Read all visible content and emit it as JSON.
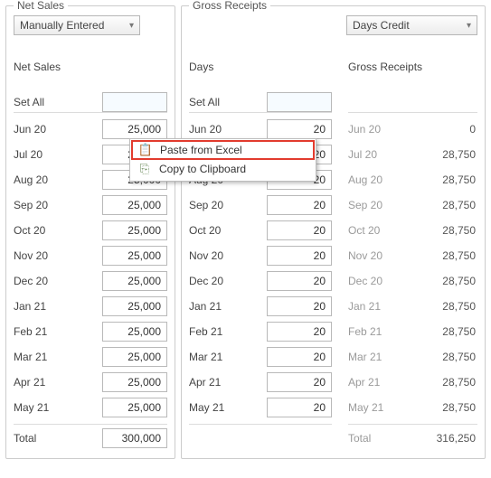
{
  "net_sales": {
    "group_title": "Net Sales",
    "dropdown": "Manually Entered",
    "section_label": "Net Sales",
    "set_all_label": "Set All",
    "set_all_value": "",
    "rows": [
      {
        "label": "Jun 20",
        "value": "25,000"
      },
      {
        "label": "Jul 20",
        "value": "25,000"
      },
      {
        "label": "Aug 20",
        "value": "25,000"
      },
      {
        "label": "Sep 20",
        "value": "25,000"
      },
      {
        "label": "Oct 20",
        "value": "25,000"
      },
      {
        "label": "Nov 20",
        "value": "25,000"
      },
      {
        "label": "Dec 20",
        "value": "25,000"
      },
      {
        "label": "Jan 21",
        "value": "25,000"
      },
      {
        "label": "Feb 21",
        "value": "25,000"
      },
      {
        "label": "Mar 21",
        "value": "25,000"
      },
      {
        "label": "Apr 21",
        "value": "25,000"
      },
      {
        "label": "May 21",
        "value": "25,000"
      }
    ],
    "total_label": "Total",
    "total_value": "300,000"
  },
  "gross": {
    "group_title": "Gross Receipts",
    "dropdown": "Days Credit",
    "days": {
      "section_label": "Days",
      "set_all_label": "Set All",
      "set_all_value": "",
      "rows": [
        {
          "label": "Jun 20",
          "value": "20"
        },
        {
          "label": "Jul 20",
          "value": "20"
        },
        {
          "label": "Aug 20",
          "value": "20"
        },
        {
          "label": "Sep 20",
          "value": "20"
        },
        {
          "label": "Oct 20",
          "value": "20"
        },
        {
          "label": "Nov 20",
          "value": "20"
        },
        {
          "label": "Dec 20",
          "value": "20"
        },
        {
          "label": "Jan 21",
          "value": "20"
        },
        {
          "label": "Feb 21",
          "value": "20"
        },
        {
          "label": "Mar 21",
          "value": "20"
        },
        {
          "label": "Apr 21",
          "value": "20"
        },
        {
          "label": "May 21",
          "value": "20"
        }
      ]
    },
    "receipts": {
      "section_label": "Gross Receipts",
      "rows": [
        {
          "label": "Jun 20",
          "value": "0"
        },
        {
          "label": "Jul 20",
          "value": "28,750"
        },
        {
          "label": "Aug 20",
          "value": "28,750"
        },
        {
          "label": "Sep 20",
          "value": "28,750"
        },
        {
          "label": "Oct 20",
          "value": "28,750"
        },
        {
          "label": "Nov 20",
          "value": "28,750"
        },
        {
          "label": "Dec 20",
          "value": "28,750"
        },
        {
          "label": "Jan 21",
          "value": "28,750"
        },
        {
          "label": "Feb 21",
          "value": "28,750"
        },
        {
          "label": "Mar 21",
          "value": "28,750"
        },
        {
          "label": "Apr 21",
          "value": "28,750"
        },
        {
          "label": "May 21",
          "value": "28,750"
        }
      ],
      "total_label": "Total",
      "total_value": "316,250"
    }
  },
  "context_menu": {
    "items": [
      {
        "icon": "paste-icon",
        "glyph": "📋",
        "label": "Paste from Excel"
      },
      {
        "icon": "copy-icon",
        "glyph": "⎘",
        "label": "Copy to Clipboard"
      }
    ]
  }
}
